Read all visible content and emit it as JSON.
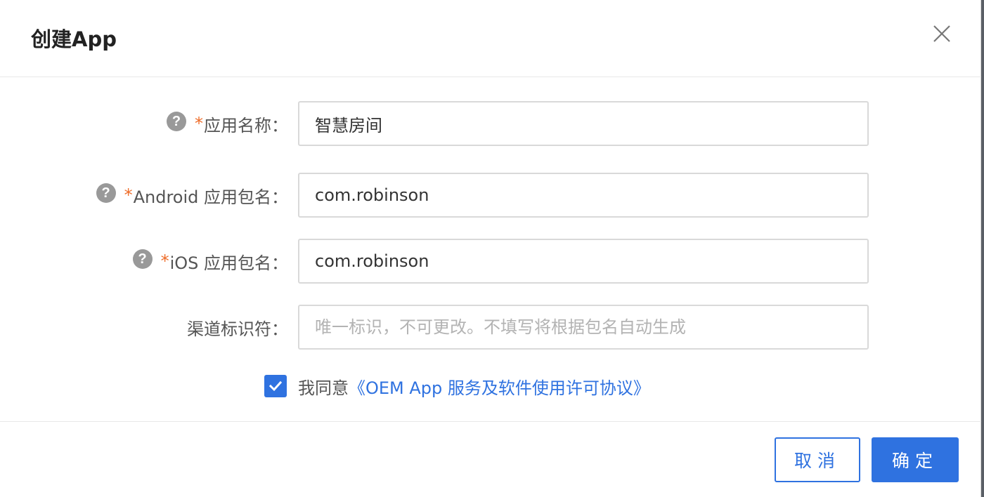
{
  "dialog": {
    "title": "创建App"
  },
  "form": {
    "app_name": {
      "required_mark": "*",
      "label": "应用名称：",
      "value": "智慧房间",
      "placeholder": ""
    },
    "android_package": {
      "required_mark": "*",
      "label": "Android 应用包名：",
      "value": "com.robinson",
      "placeholder": ""
    },
    "ios_package": {
      "required_mark": "*",
      "label": "iOS 应用包名：",
      "value": "com.robinson",
      "placeholder": ""
    },
    "channel_id": {
      "label": "渠道标识符：",
      "value": "",
      "placeholder": "唯一标识，不可更改。不填写将根据包名自动生成"
    },
    "agreement": {
      "checked": true,
      "text": "我同意",
      "link": "《OEM App 服务及软件使用许可协议》"
    }
  },
  "footer": {
    "cancel_label": "取消",
    "ok_label": "确定"
  },
  "colors": {
    "accent": "#2f72e0",
    "required": "#ee6c29",
    "help_icon": "#999999"
  },
  "icons": {
    "close": "close-icon",
    "help": "question-circle-icon",
    "check": "checkmark-icon"
  }
}
